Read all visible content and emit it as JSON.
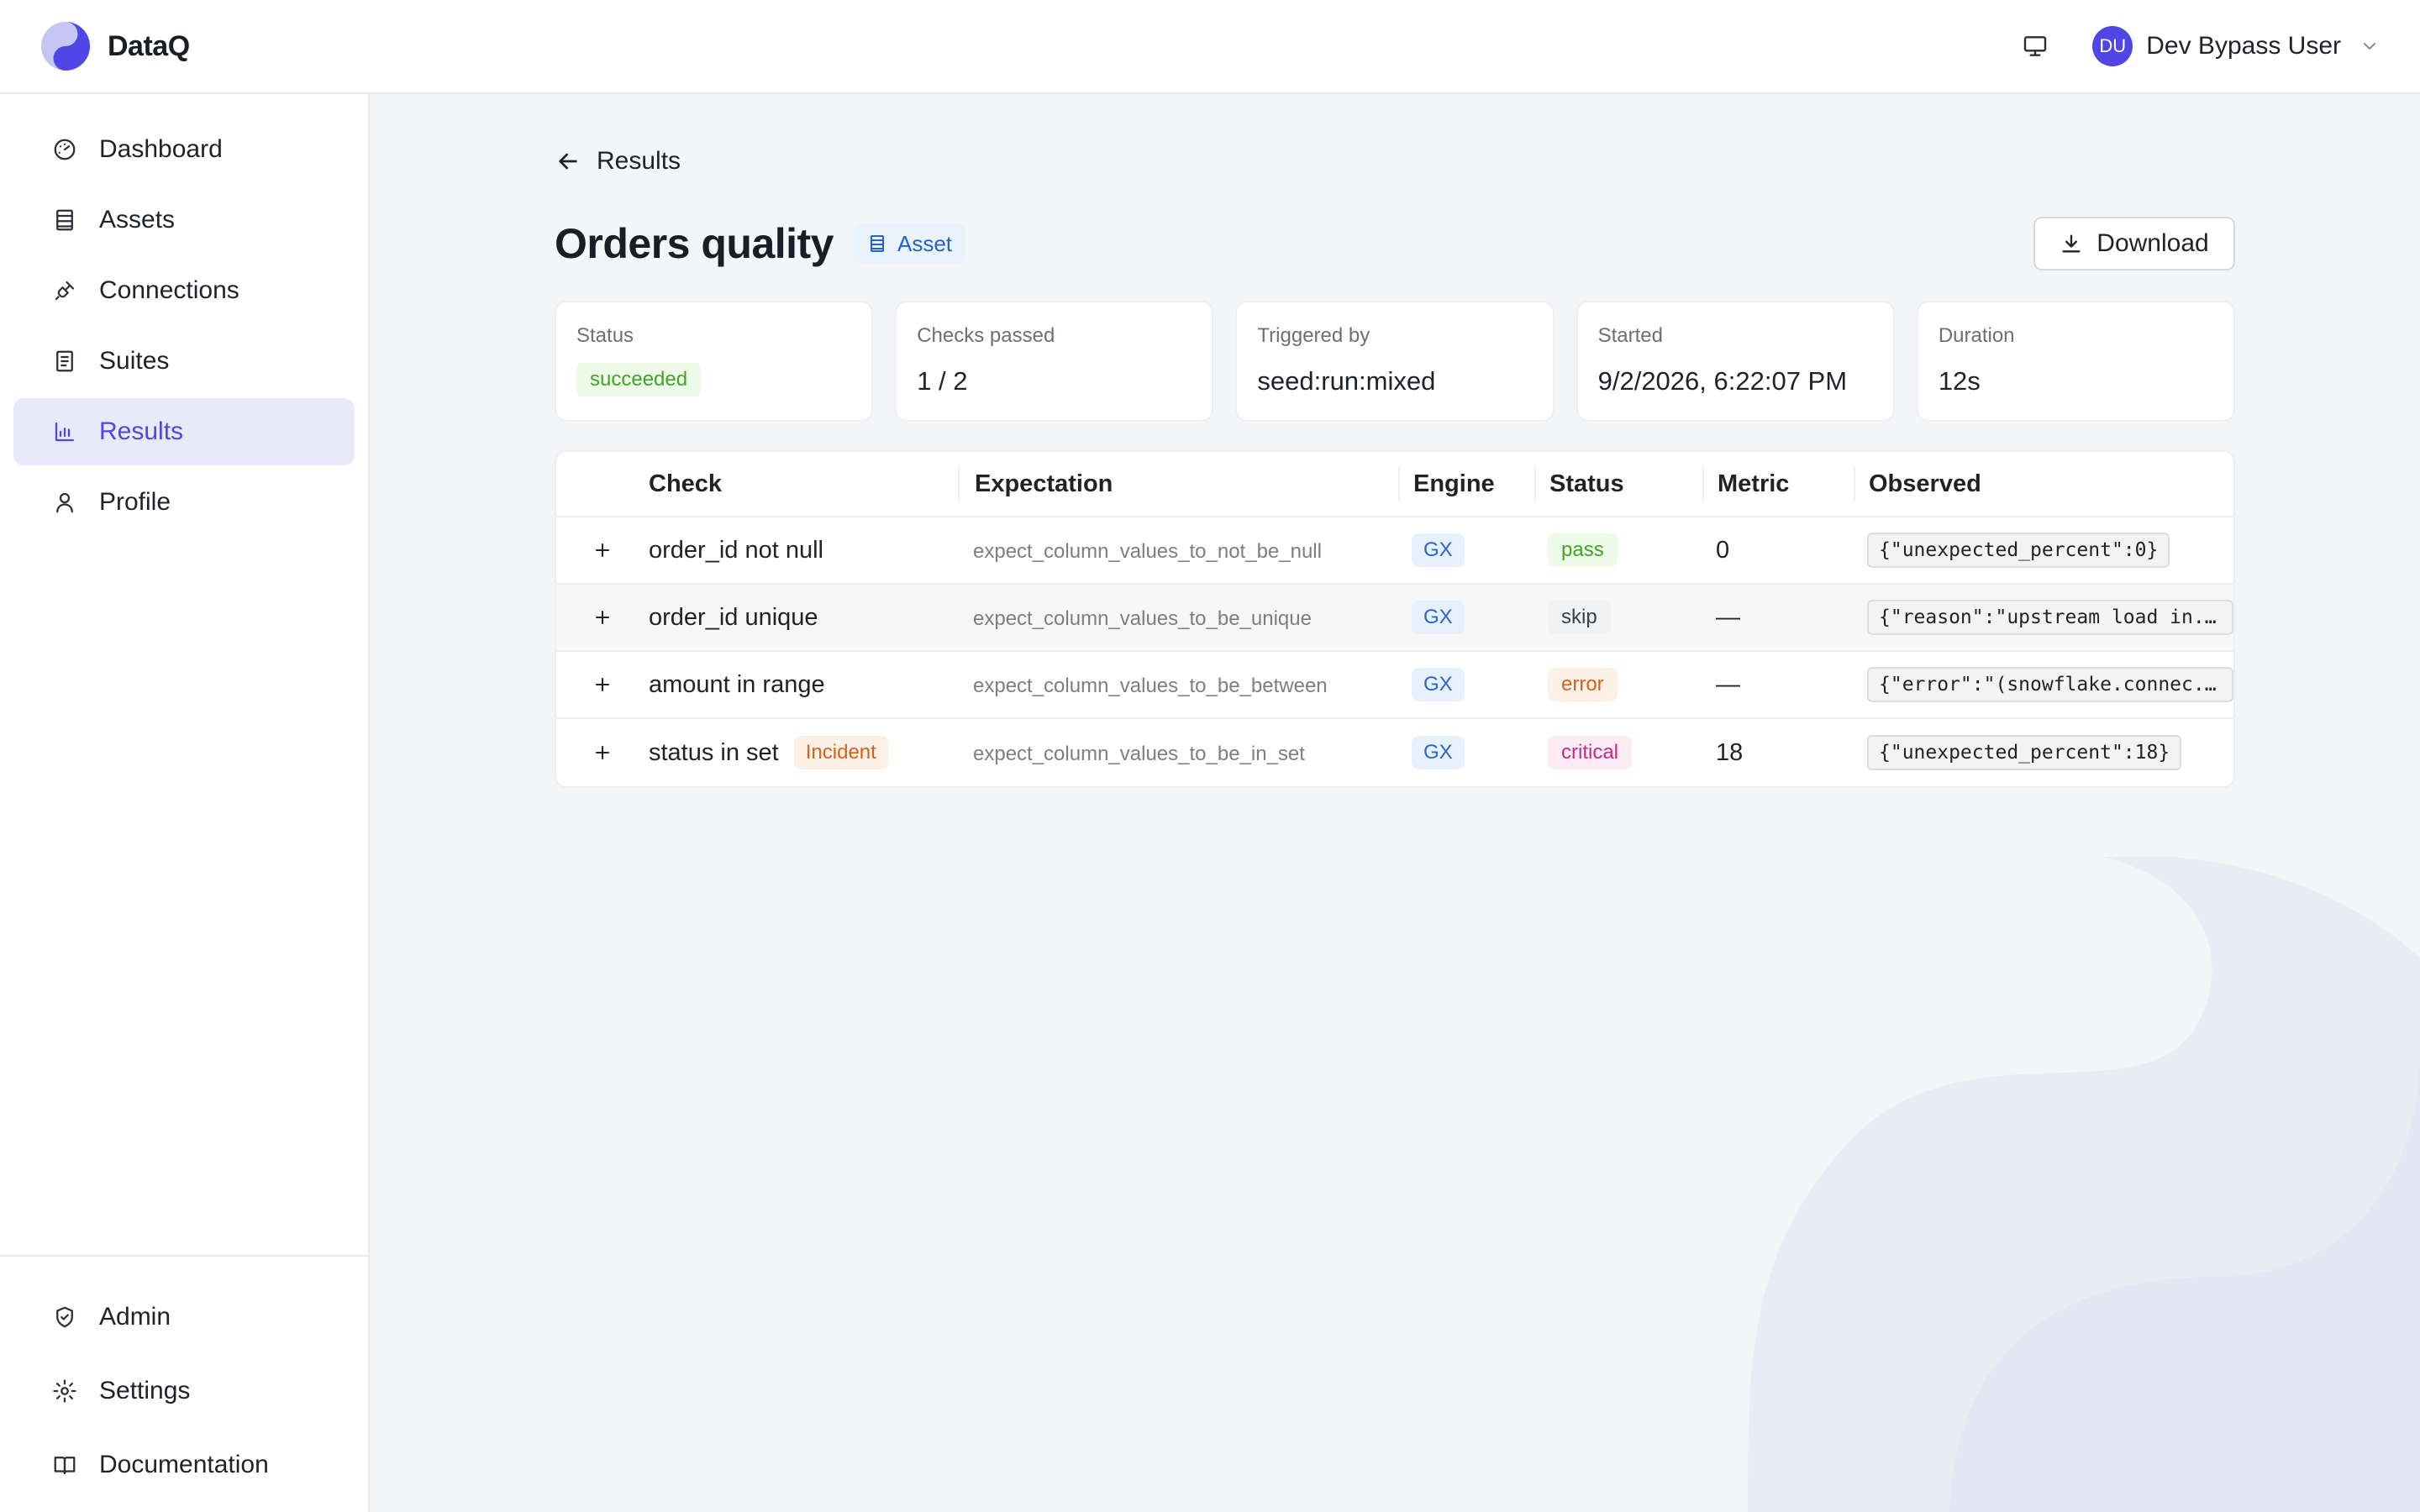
{
  "app": {
    "name": "DataQ"
  },
  "header": {
    "user_initials": "DU",
    "user_name": "Dev Bypass User"
  },
  "sidebar": {
    "items": [
      {
        "label": "Dashboard",
        "icon": "gauge-icon"
      },
      {
        "label": "Assets",
        "icon": "table-icon"
      },
      {
        "label": "Connections",
        "icon": "plug-icon"
      },
      {
        "label": "Suites",
        "icon": "checklist-icon"
      },
      {
        "label": "Results",
        "icon": "bar-chart-icon",
        "active": true
      },
      {
        "label": "Profile",
        "icon": "user-icon"
      }
    ],
    "bottom_items": [
      {
        "label": "Admin",
        "icon": "shield-check-icon"
      },
      {
        "label": "Settings",
        "icon": "gear-icon"
      },
      {
        "label": "Documentation",
        "icon": "book-icon"
      }
    ]
  },
  "page": {
    "back_label": "Results",
    "title": "Orders quality",
    "type_chip": "Asset",
    "download_label": "Download"
  },
  "summary": {
    "status": {
      "label": "Status",
      "value": "succeeded"
    },
    "checks": {
      "label": "Checks passed",
      "value": "1 / 2"
    },
    "trigger": {
      "label": "Triggered by",
      "value": "seed:run:mixed"
    },
    "started": {
      "label": "Started",
      "value": "9/2/2026, 6:22:07 PM"
    },
    "duration": {
      "label": "Duration",
      "value": "12s"
    }
  },
  "table": {
    "columns": {
      "check": "Check",
      "expectation": "Expectation",
      "engine": "Engine",
      "status": "Status",
      "metric": "Metric",
      "observed": "Observed"
    },
    "rows": [
      {
        "check": "order_id not null",
        "incident": "",
        "expectation": "expect_column_values_to_not_be_null",
        "engine": "GX",
        "status": "pass",
        "metric": "0",
        "observed": "{\"unexpected_percent\":0}"
      },
      {
        "check": "order_id unique",
        "incident": "",
        "expectation": "expect_column_values_to_be_unique",
        "engine": "GX",
        "status": "skip",
        "metric": "—",
        "observed": "{\"reason\":\"upstream load in..."
      },
      {
        "check": "amount in range",
        "incident": "",
        "expectation": "expect_column_values_to_be_between",
        "engine": "GX",
        "status": "error",
        "metric": "—",
        "observed": "{\"error\":\"(snowflake.connec..."
      },
      {
        "check": "status in set",
        "incident": "Incident",
        "expectation": "expect_column_values_to_be_in_set",
        "engine": "GX",
        "status": "critical",
        "metric": "18",
        "observed": "{\"unexpected_percent\":18}"
      }
    ]
  },
  "colors": {
    "accent": "#4f46e5",
    "pass": "#3fa524",
    "error": "#d4621a",
    "critical": "#c8268a"
  }
}
